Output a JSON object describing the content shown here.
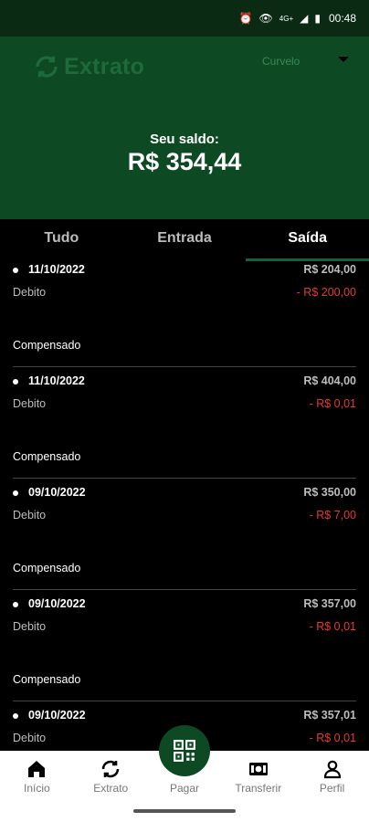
{
  "status_bar": {
    "time": "00:48",
    "network": "4G+"
  },
  "header": {
    "title": "Extrato",
    "city": "Curvelo",
    "balance_label": "Seu saldo:",
    "balance_value": "R$ 354,44",
    "bg_color": "#0d4a24"
  },
  "tabs": [
    {
      "label": "Tudo",
      "active": false
    },
    {
      "label": "Entrada",
      "active": false
    },
    {
      "label": "Saída",
      "active": true
    }
  ],
  "transactions": [
    {
      "date": "11/10/2022",
      "amount": "R$ 204,00",
      "type": "Debito",
      "debit": "- R$ 200,00",
      "status": "Compensado"
    },
    {
      "date": "11/10/2022",
      "amount": "R$ 404,00",
      "type": "Debito",
      "debit": "- R$ 0,01",
      "status": "Compensado"
    },
    {
      "date": "09/10/2022",
      "amount": "R$ 350,00",
      "type": "Debito",
      "debit": "- R$ 7,00",
      "status": "Compensado"
    },
    {
      "date": "09/10/2022",
      "amount": "R$ 357,00",
      "type": "Debito",
      "debit": "- R$ 0,01",
      "status": "Compensado"
    },
    {
      "date": "09/10/2022",
      "amount": "R$ 357,01",
      "type": "Debito",
      "debit": "- R$ 0,01",
      "status": ""
    }
  ],
  "bottom_nav": [
    {
      "label": "Início",
      "icon": "home-icon"
    },
    {
      "label": "Extrato",
      "icon": "sync-icon"
    },
    {
      "label": "Pagar",
      "icon": "qr-code-icon"
    },
    {
      "label": "Transferir",
      "icon": "money-transfer-icon"
    },
    {
      "label": "Perfil",
      "icon": "user-icon"
    }
  ],
  "colors": {
    "accent": "#0d4a24",
    "debit": "#e53935",
    "tab_indicator": "#1a5f35"
  }
}
